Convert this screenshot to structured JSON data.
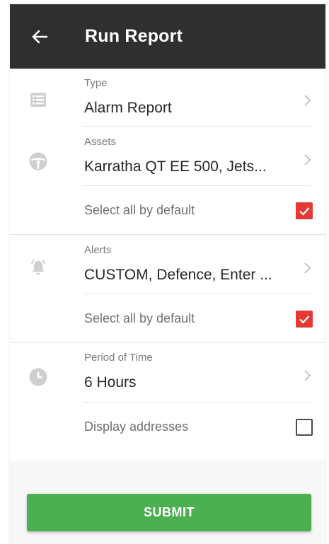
{
  "appbar": {
    "title": "Run Report",
    "back_icon": "arrow-left-icon",
    "background": "#2f2f2f"
  },
  "form": {
    "type": {
      "label": "Type",
      "value": "Alarm Report",
      "icon": "list-icon"
    },
    "assets": {
      "label": "Assets",
      "value": "Karratha QT EE 500, Jets...",
      "icon": "steering-wheel-icon",
      "select_all_label": "Select all by default",
      "select_all_checked": true
    },
    "alerts": {
      "label": "Alerts",
      "value": "CUSTOM, Defence, Enter ...",
      "icon": "bell-alert-icon",
      "select_all_label": "Select all by default",
      "select_all_checked": true
    },
    "period": {
      "label": "Period of Time",
      "value": "6 Hours",
      "icon": "clock-icon"
    },
    "display_addresses": {
      "label": "Display addresses",
      "checked": false
    }
  },
  "submit": {
    "label": "SUBMIT",
    "color": "#4caf50"
  },
  "colors": {
    "checkbox_on": "#e53935",
    "icon_gray": "#cfcfcf"
  }
}
